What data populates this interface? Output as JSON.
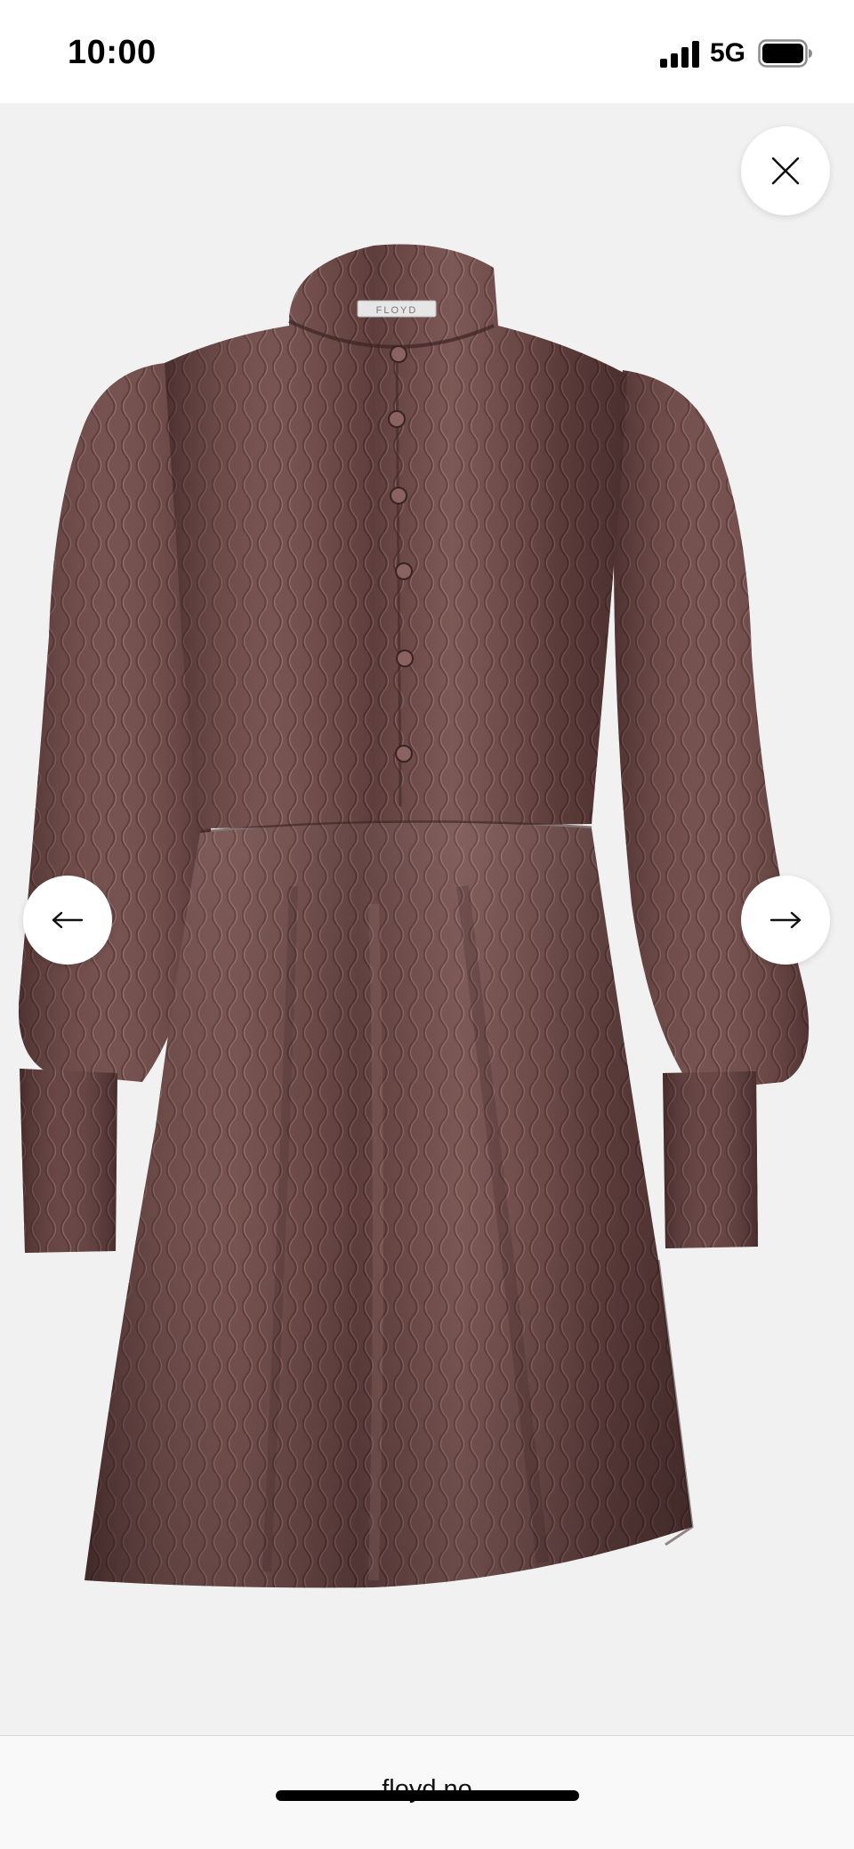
{
  "status_bar": {
    "time": "10:00",
    "network": "5G"
  },
  "viewer": {
    "product_image": "brown textured satin mini dress with long puff sleeves, stand collar and button placket",
    "label_text": "FLOYD",
    "close_icon": "close-icon",
    "prev_icon": "arrow-left-icon",
    "next_icon": "arrow-right-icon"
  },
  "browser": {
    "url": "floyd.no"
  },
  "colors": {
    "viewer_background": "#f1f1f1",
    "dress_base": "#6e4a48",
    "dress_highlight": "#a27c78",
    "dress_shadow": "#3f2625"
  }
}
